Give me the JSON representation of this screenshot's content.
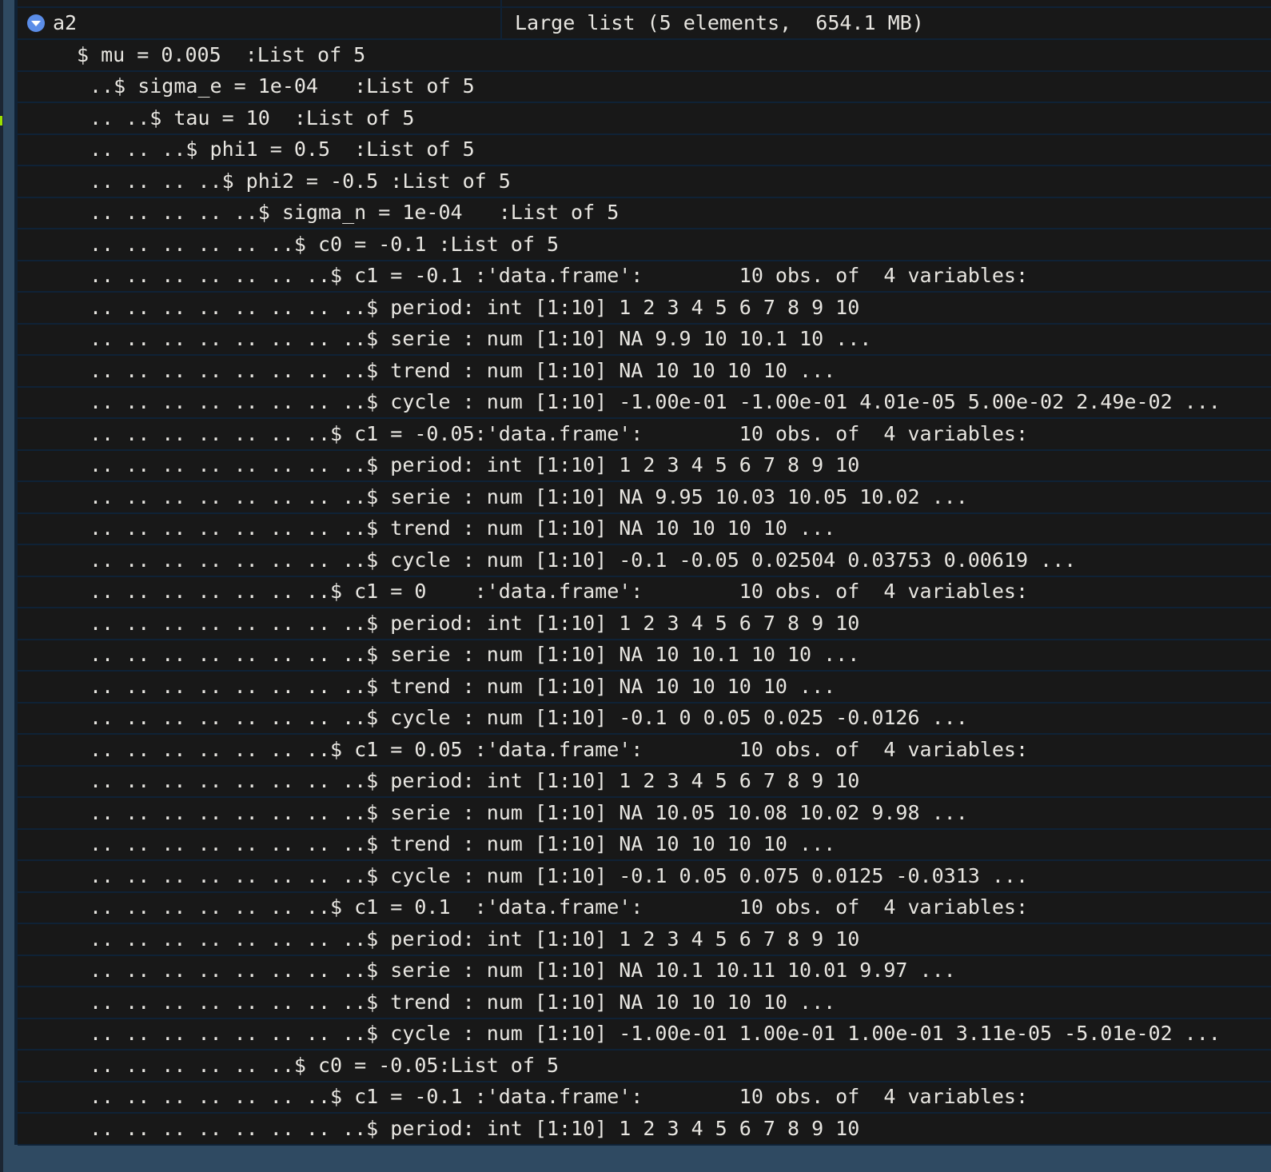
{
  "variable": {
    "name": "a2",
    "summary": "Large list (5 elements,  654.1 MB)",
    "expanded": true
  },
  "lines": [
    {
      "indent": "    ",
      "text": "$ mu = 0.005  :List of 5"
    },
    {
      "indent": "     ",
      "text": "..$ sigma_e = 1e-04   :List of 5"
    },
    {
      "indent": "     ",
      "text": ".. ..$ tau = 10  :List of 5"
    },
    {
      "indent": "     ",
      "text": ".. .. ..$ phi1 = 0.5  :List of 5"
    },
    {
      "indent": "     ",
      "text": ".. .. .. ..$ phi2 = -0.5 :List of 5"
    },
    {
      "indent": "     ",
      "text": ".. .. .. .. ..$ sigma_n = 1e-04   :List of 5"
    },
    {
      "indent": "     ",
      "text": ".. .. .. .. .. ..$ c0 = -0.1 :List of 5"
    },
    {
      "indent": "     ",
      "text": ".. .. .. .. .. .. ..$ c1 = -0.1 :'data.frame':\t10 obs. of  4 variables:"
    },
    {
      "indent": "     ",
      "text": ".. .. .. .. .. .. .. ..$ period: int [1:10] 1 2 3 4 5 6 7 8 9 10"
    },
    {
      "indent": "     ",
      "text": ".. .. .. .. .. .. .. ..$ serie : num [1:10] NA 9.9 10 10.1 10 ..."
    },
    {
      "indent": "     ",
      "text": ".. .. .. .. .. .. .. ..$ trend : num [1:10] NA 10 10 10 10 ..."
    },
    {
      "indent": "     ",
      "text": ".. .. .. .. .. .. .. ..$ cycle : num [1:10] -1.00e-01 -1.00e-01 4.01e-05 5.00e-02 2.49e-02 ..."
    },
    {
      "indent": "     ",
      "text": ".. .. .. .. .. .. ..$ c1 = -0.05:'data.frame':\t10 obs. of  4 variables:"
    },
    {
      "indent": "     ",
      "text": ".. .. .. .. .. .. .. ..$ period: int [1:10] 1 2 3 4 5 6 7 8 9 10"
    },
    {
      "indent": "     ",
      "text": ".. .. .. .. .. .. .. ..$ serie : num [1:10] NA 9.95 10.03 10.05 10.02 ..."
    },
    {
      "indent": "     ",
      "text": ".. .. .. .. .. .. .. ..$ trend : num [1:10] NA 10 10 10 10 ..."
    },
    {
      "indent": "     ",
      "text": ".. .. .. .. .. .. .. ..$ cycle : num [1:10] -0.1 -0.05 0.02504 0.03753 0.00619 ..."
    },
    {
      "indent": "     ",
      "text": ".. .. .. .. .. .. ..$ c1 = 0    :'data.frame':\t10 obs. of  4 variables:"
    },
    {
      "indent": "     ",
      "text": ".. .. .. .. .. .. .. ..$ period: int [1:10] 1 2 3 4 5 6 7 8 9 10"
    },
    {
      "indent": "     ",
      "text": ".. .. .. .. .. .. .. ..$ serie : num [1:10] NA 10 10.1 10 10 ..."
    },
    {
      "indent": "     ",
      "text": ".. .. .. .. .. .. .. ..$ trend : num [1:10] NA 10 10 10 10 ..."
    },
    {
      "indent": "     ",
      "text": ".. .. .. .. .. .. .. ..$ cycle : num [1:10] -0.1 0 0.05 0.025 -0.0126 ..."
    },
    {
      "indent": "     ",
      "text": ".. .. .. .. .. .. ..$ c1 = 0.05 :'data.frame':\t10 obs. of  4 variables:"
    },
    {
      "indent": "     ",
      "text": ".. .. .. .. .. .. .. ..$ period: int [1:10] 1 2 3 4 5 6 7 8 9 10"
    },
    {
      "indent": "     ",
      "text": ".. .. .. .. .. .. .. ..$ serie : num [1:10] NA 10.05 10.08 10.02 9.98 ..."
    },
    {
      "indent": "     ",
      "text": ".. .. .. .. .. .. .. ..$ trend : num [1:10] NA 10 10 10 10 ..."
    },
    {
      "indent": "     ",
      "text": ".. .. .. .. .. .. .. ..$ cycle : num [1:10] -0.1 0.05 0.075 0.0125 -0.0313 ..."
    },
    {
      "indent": "     ",
      "text": ".. .. .. .. .. .. ..$ c1 = 0.1  :'data.frame':\t10 obs. of  4 variables:"
    },
    {
      "indent": "     ",
      "text": ".. .. .. .. .. .. .. ..$ period: int [1:10] 1 2 3 4 5 6 7 8 9 10"
    },
    {
      "indent": "     ",
      "text": ".. .. .. .. .. .. .. ..$ serie : num [1:10] NA 10.1 10.11 10.01 9.97 ..."
    },
    {
      "indent": "     ",
      "text": ".. .. .. .. .. .. .. ..$ trend : num [1:10] NA 10 10 10 10 ..."
    },
    {
      "indent": "     ",
      "text": ".. .. .. .. .. .. .. ..$ cycle : num [1:10] -1.00e-01 1.00e-01 1.00e-01 3.11e-05 -5.01e-02 ..."
    },
    {
      "indent": "     ",
      "text": ".. .. .. .. .. ..$ c0 = -0.05:List of 5"
    },
    {
      "indent": "     ",
      "text": ".. .. .. .. .. .. ..$ c1 = -0.1 :'data.frame':\t10 obs. of  4 variables:"
    },
    {
      "indent": "     ",
      "text": ".. .. .. .. .. .. .. ..$ period: int [1:10] 1 2 3 4 5 6 7 8 9 10"
    }
  ],
  "colors": {
    "background": "#181818",
    "text": "#e8e6e1",
    "row_divider": "#0f2236",
    "expand_button": "#5b8de8",
    "frame": "#2f4a62"
  }
}
